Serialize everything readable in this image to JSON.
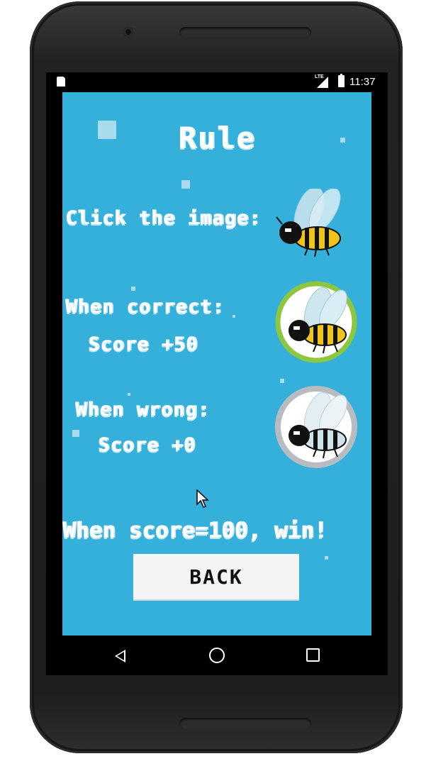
{
  "status_bar": {
    "time": "11:37",
    "network_label": "LTE"
  },
  "screen": {
    "title": "Rule",
    "rules": {
      "click_instruction": "Click the image:",
      "correct_heading": "When correct:",
      "correct_score": "Score +50",
      "wrong_heading": "When wrong:",
      "wrong_score": "Score +0",
      "win_condition": "When score=100, win!"
    },
    "back_button_label": "BACK"
  },
  "colors": {
    "background": "#35b0da",
    "correct_ring": "#8dc63f",
    "wrong_ring": "#b8bcc0",
    "bee_yellow": "#f0c419"
  },
  "icons": {
    "plain_bee": "bee-icon",
    "correct_bee": "bee-correct-icon",
    "wrong_bee": "bee-wrong-icon",
    "nav_back": "nav-back-icon",
    "nav_home": "nav-home-icon",
    "nav_recent": "nav-recent-icon"
  }
}
